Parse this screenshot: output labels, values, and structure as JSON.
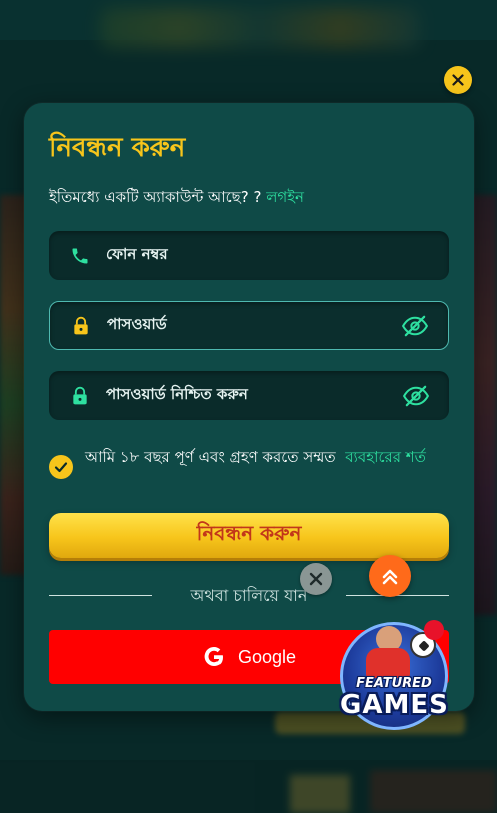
{
  "modal": {
    "title": "নিবন্ধন করুন",
    "have_account_text": "ইতিমধ্যে একটি অ্যাকাউন্ট আছে? ?",
    "login_link": "লগইন",
    "phone_placeholder": "ফোন নম্বর",
    "password_placeholder": "পাসওয়ার্ড",
    "confirm_password_placeholder": "পাসওয়ার্ড নিশ্চিত করুন",
    "agree_text": "আমি ১৮ বছর পূর্ণ এবং গ্রহণ করতে সম্মত",
    "terms_link": "ব্যবহারের শর্ত",
    "agree_checked": true,
    "submit_label": "নিবন্ধন করুন",
    "divider_text": "অথবা চালিয়ে যান",
    "google_label": "Google"
  },
  "icons": {
    "close": "close-icon",
    "phone": "phone-icon",
    "lock": "lock-icon",
    "eye_off": "eye-off-icon",
    "check": "check-icon",
    "google": "google-icon",
    "scroll_top": "double-chevron-up-icon"
  },
  "promo": {
    "line1": "FEATURED",
    "line2": "GAMES"
  },
  "colors": {
    "accent_yellow": "#f7c51b",
    "link_green": "#2ee0a0",
    "modal_bg": "#0f4a47",
    "field_bg": "#0a2b2a",
    "google_red": "#ff0000",
    "scroll_orange": "#ff6a1a",
    "submit_text": "#c2361a"
  }
}
